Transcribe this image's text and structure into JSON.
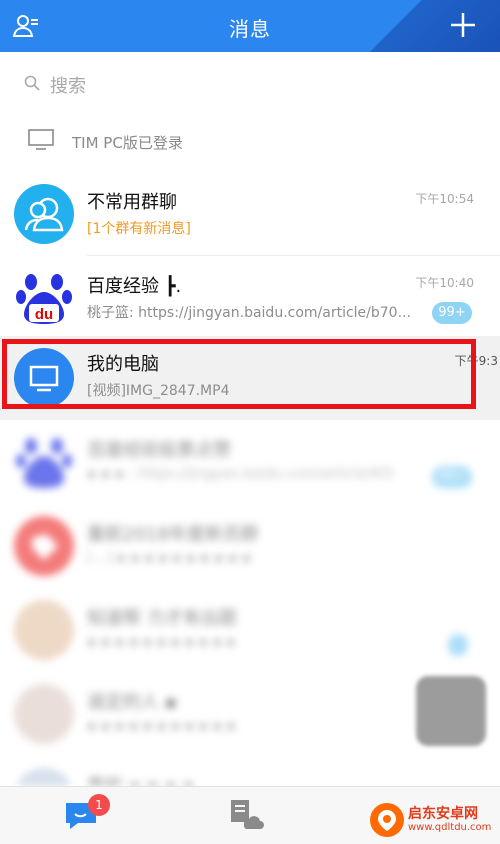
{
  "header": {
    "title": "消息",
    "accent": "#2b86f0"
  },
  "search": {
    "placeholder": "搜索"
  },
  "pc_status": {
    "label": "TIM PC版已登录"
  },
  "chats": [
    {
      "name": "不常用群聊",
      "preview": "[1个群有新消息]",
      "time": "下午10:54"
    },
    {
      "name": "百度经验 ┣.",
      "preview": "桃子篮: https://jingyan.baidu.com/article/b70...",
      "time": "下午10:40",
      "badge": "99+"
    },
    {
      "name": "我的电脑",
      "preview": "[视频]IMG_2847.MP4",
      "time": "下午9:3"
    },
    {
      "name": "百度经验投票点赞",
      "preview": "▪ ▪ ▪ : https://jingyan.baidu.com/article/6f3",
      "time": "",
      "badge": "99+"
    },
    {
      "name": "重航2018年度新员群",
      "preview": "[…] ▪ ▪ ▪ ▪ ▪ ▪ ▪ ▪ ▪ ▪",
      "time": ""
    },
    {
      "name": "知道帮 力才有出题",
      "preview": "▪ ▪ ▪ ▪ ▪ ▪ ▪ ▪ ▪ ▪ ▪",
      "time": ""
    },
    {
      "name": "滋定的人 ▪",
      "preview": "▪ ▪ ▪ ▪ ▪ ▪ ▪ ▪ ▪ ▪ ▪",
      "time": ""
    },
    {
      "name": "重航 ▪ ▪ ▪ ▪",
      "preview": "",
      "time": ""
    }
  ],
  "bottom_nav": {
    "messages_badge": "1"
  },
  "watermark": {
    "name": "启东安卓网",
    "url": "www.qdltdu.com"
  }
}
